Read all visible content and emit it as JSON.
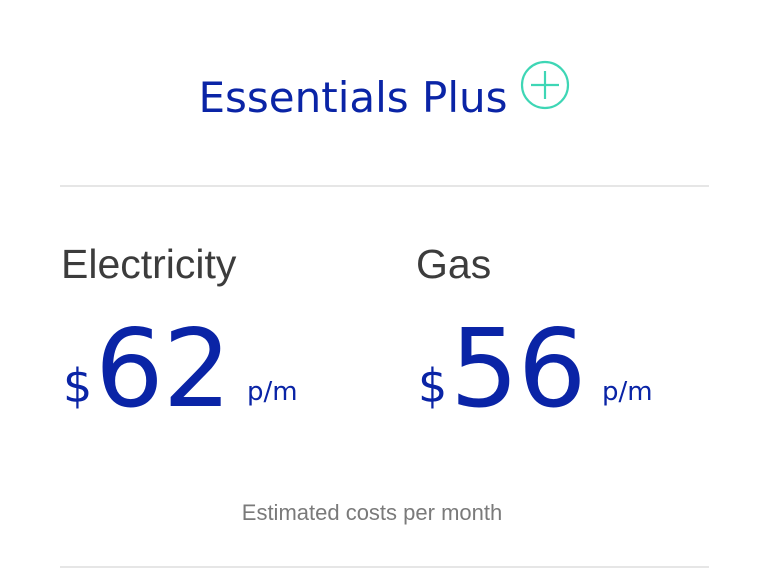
{
  "plan": {
    "title": "Essentials Plus",
    "icon": "plus-circle-icon",
    "icon_color": "#3ed6b5"
  },
  "colors": {
    "primary": "#0a24a6",
    "label": "#3c3c3c",
    "muted": "#7a7a7a",
    "divider": "#e6e6e6"
  },
  "electricity": {
    "label": "Electricity",
    "currency": "$",
    "amount": "62",
    "period": "p/m"
  },
  "gas": {
    "label": "Gas",
    "currency": "$",
    "amount": "56",
    "period": "p/m"
  },
  "footnote": "Estimated costs per month"
}
